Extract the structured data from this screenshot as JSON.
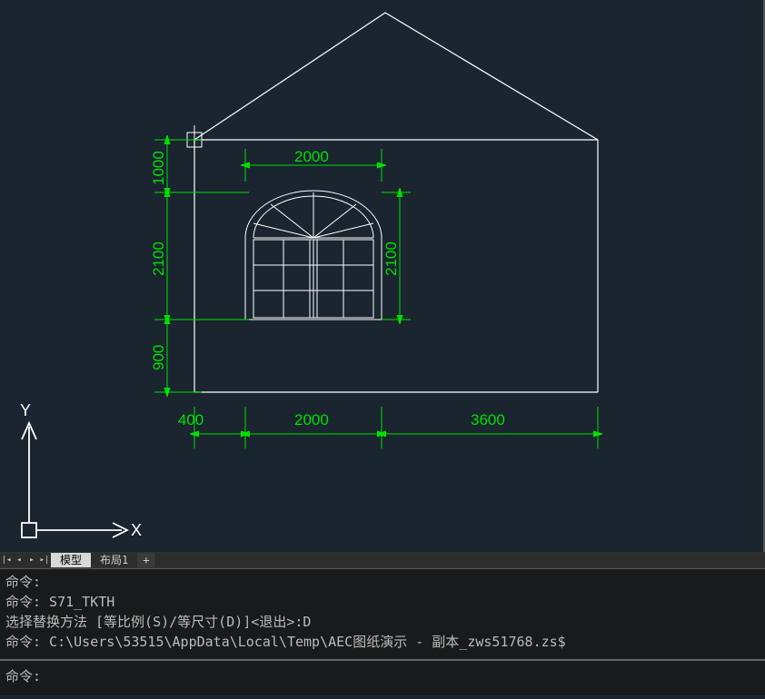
{
  "tabs": {
    "model": "模型",
    "layout1": "布局1"
  },
  "axes": {
    "x": "X",
    "y": "Y"
  },
  "dims": {
    "left_top": "1000",
    "left_mid": "2100",
    "left_bot": "900",
    "top_h": "2000",
    "right_v": "2100",
    "bot_1": "400",
    "bot_2": "2000",
    "bot_3": "3600"
  },
  "cmd": {
    "l1": "命令:",
    "l2": "命令: S71_TKTH",
    "l3": "选择替换方法 [等比例(S)/等尺寸(D)]<退出>:D",
    "l4": "命令: C:\\Users\\53515\\AppData\\Local\\Temp\\AEC图纸演示 - 副本_zws51768.zs$",
    "prompt": "命令:"
  }
}
